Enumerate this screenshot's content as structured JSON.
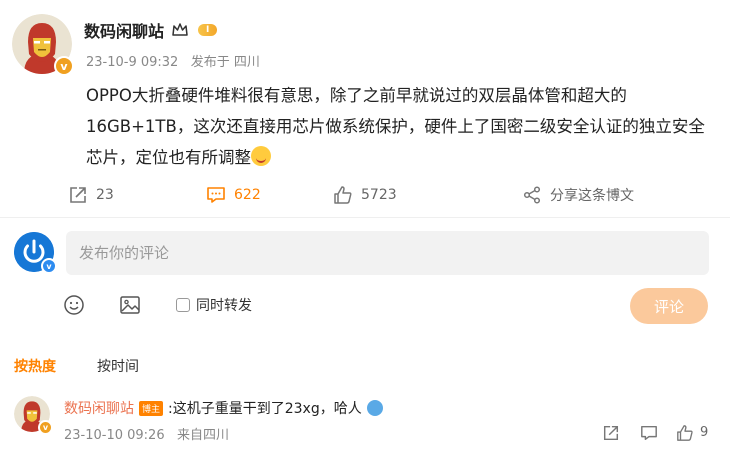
{
  "post": {
    "author": "数码闲聊站",
    "level": "I",
    "timestamp": "23-10-9 09:32",
    "source": "发布于 四川",
    "text": "OPPO大折叠硬件堆料很有意思，除了之前早就说过的双层晶体管和超大的16GB+1TB，这次还直接用芯片做系统保护，硬件上了国密二级安全认证的独立安全芯片，定位也有所调整",
    "emoji_name": "smiling-face-emoji"
  },
  "actions": {
    "repost_count": "23",
    "comment_count": "622",
    "like_count": "5723",
    "share_label": "分享这条博文"
  },
  "composer": {
    "placeholder": "发布你的评论",
    "repost_label": "同时转发",
    "submit_label": "评论"
  },
  "sort": {
    "hot": "按热度",
    "time": "按时间"
  },
  "comments": [
    {
      "author": "数码闲聊站",
      "tag": "博主",
      "text": ":这机子重量干到了23xg，哈人",
      "timestamp": "23-10-10 09:26",
      "location": "来自四川",
      "like_count": "9"
    }
  ],
  "colors": {
    "accent": "#ff8200",
    "name_link": "#eb7350",
    "submit_disabled": "#fbc99c",
    "input_bg": "#f2f2f2"
  }
}
